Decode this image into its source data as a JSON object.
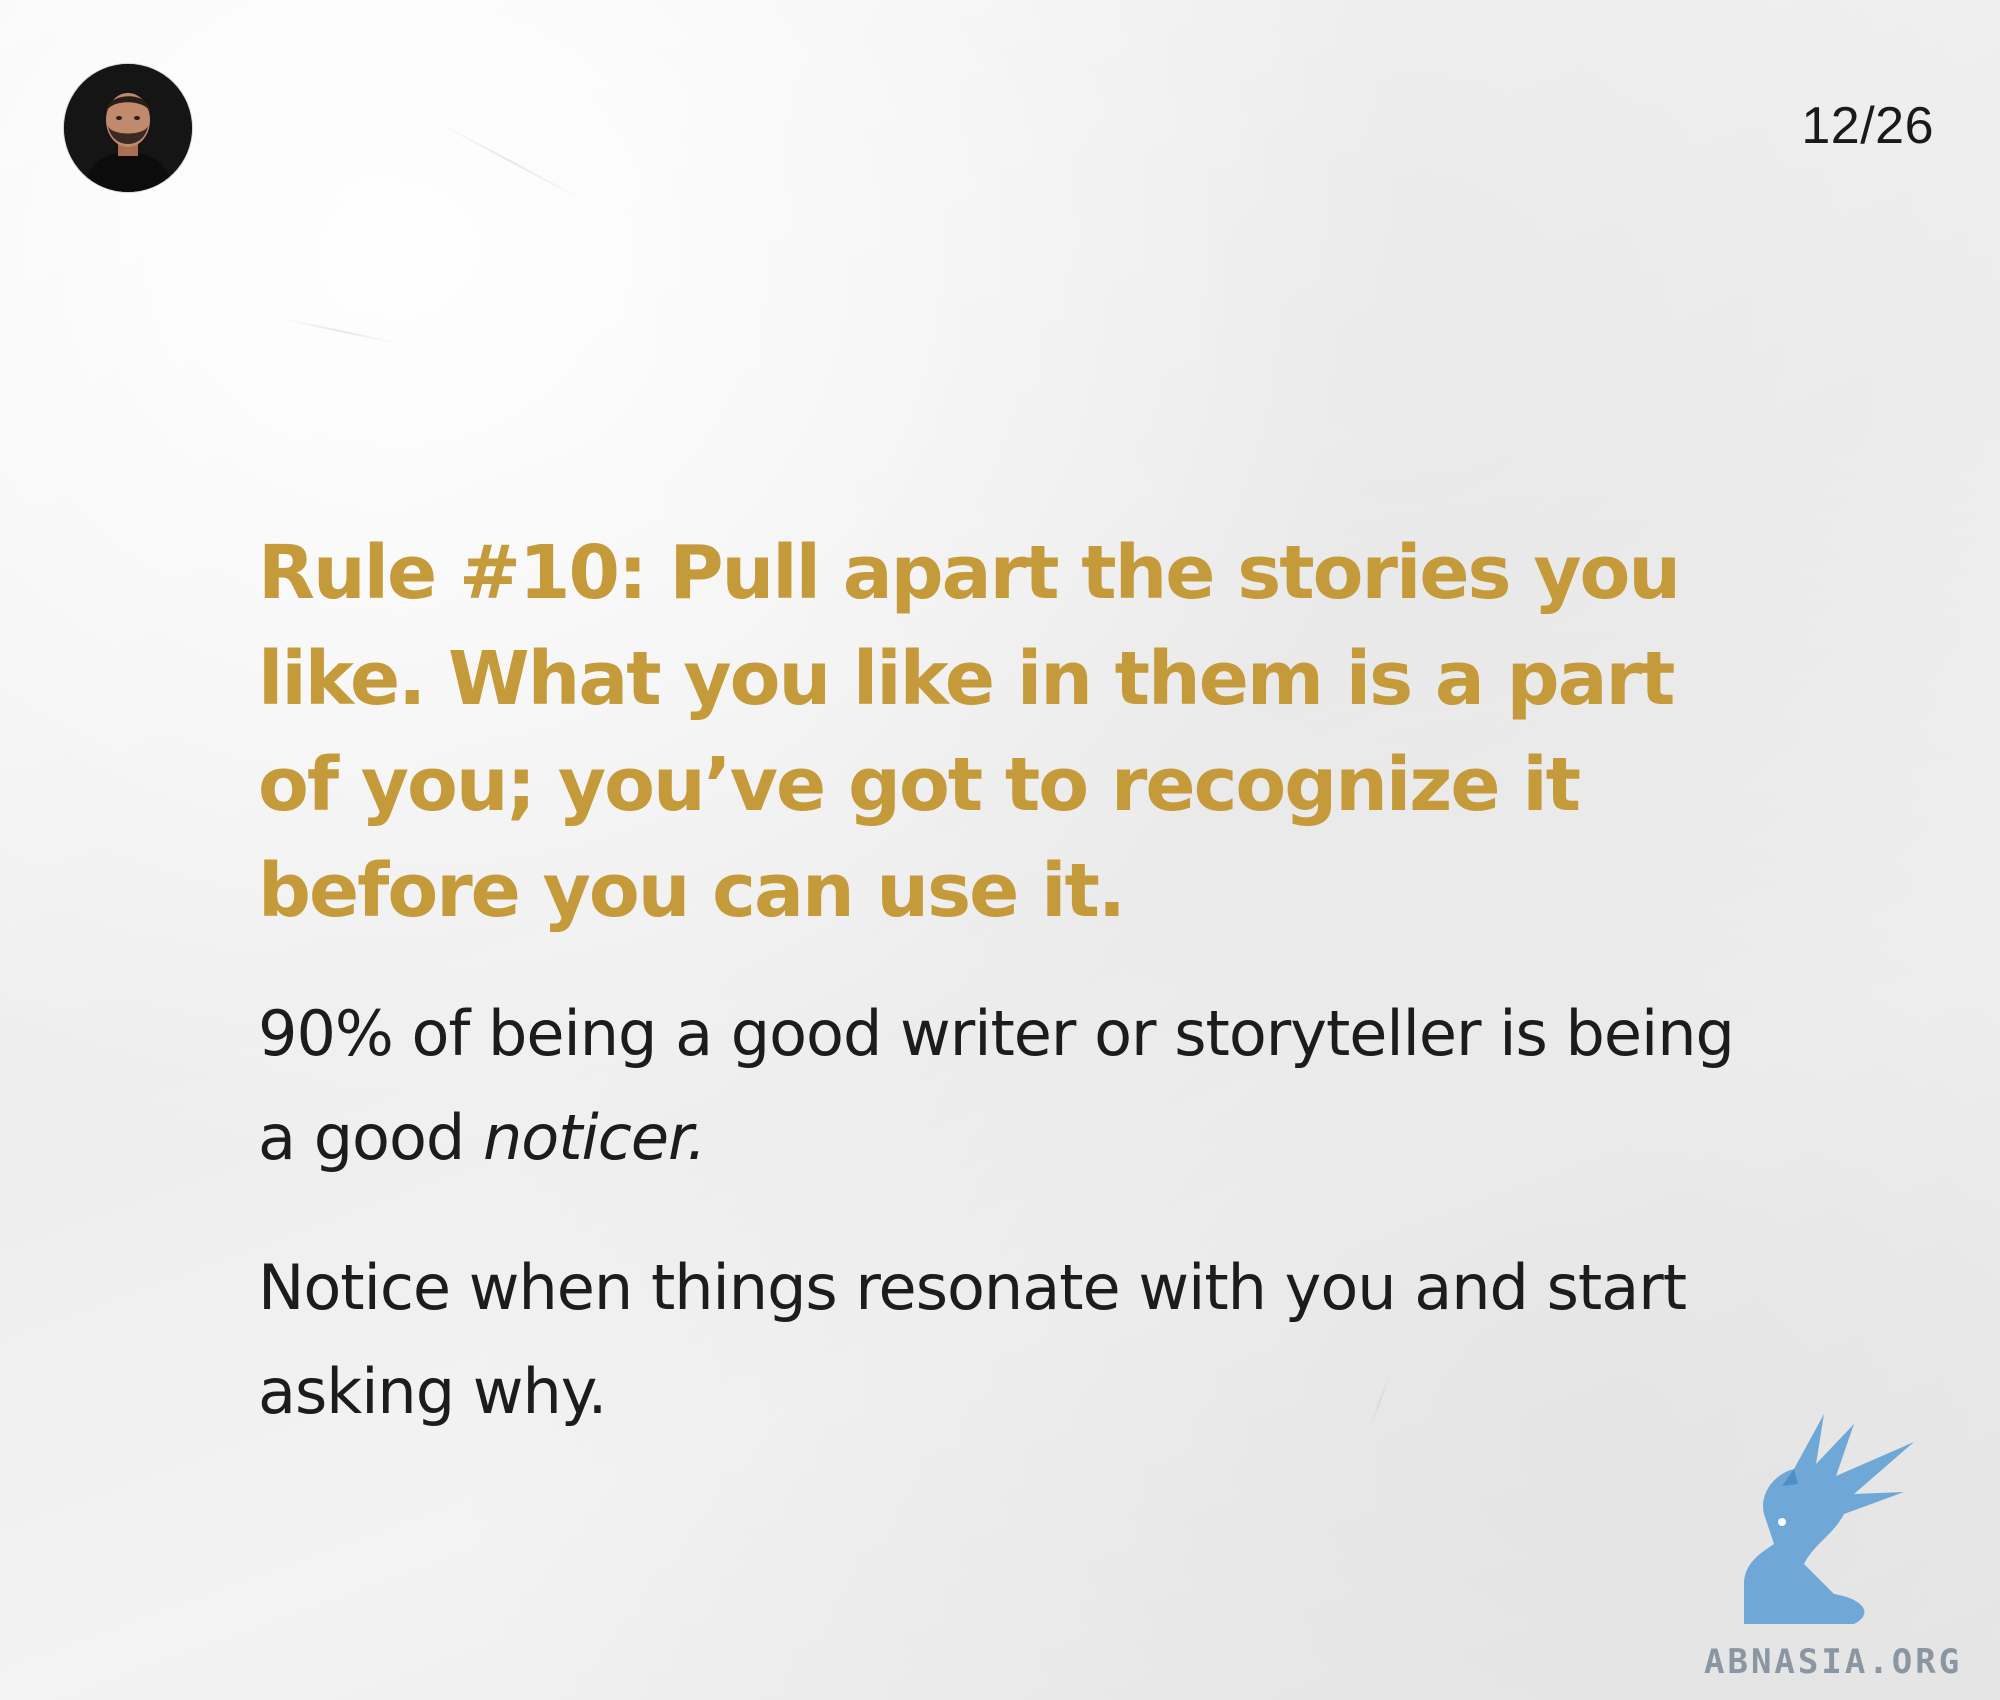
{
  "header": {
    "avatar_icon": "person-avatar-icon",
    "page_counter": "12/26"
  },
  "main": {
    "headline": "Rule #10: Pull apart the stories you like. What you like in them is a part of you; you’ve got to recognize it before you can use it.",
    "paragraph_1": {
      "text_before": "90% of being a good writer or storyteller is being a good ",
      "emphasis": "noticer."
    },
    "paragraph_2": "Notice when things resonate with you and start asking why."
  },
  "watermark": {
    "icon": "griffin-logo-icon",
    "text": "ABNASIA.ORG"
  },
  "colors": {
    "headline": "#c49a3a",
    "body_text": "#1c1c1c",
    "background": "#f0f0f0",
    "watermark_logo": "#6fa8d6"
  }
}
